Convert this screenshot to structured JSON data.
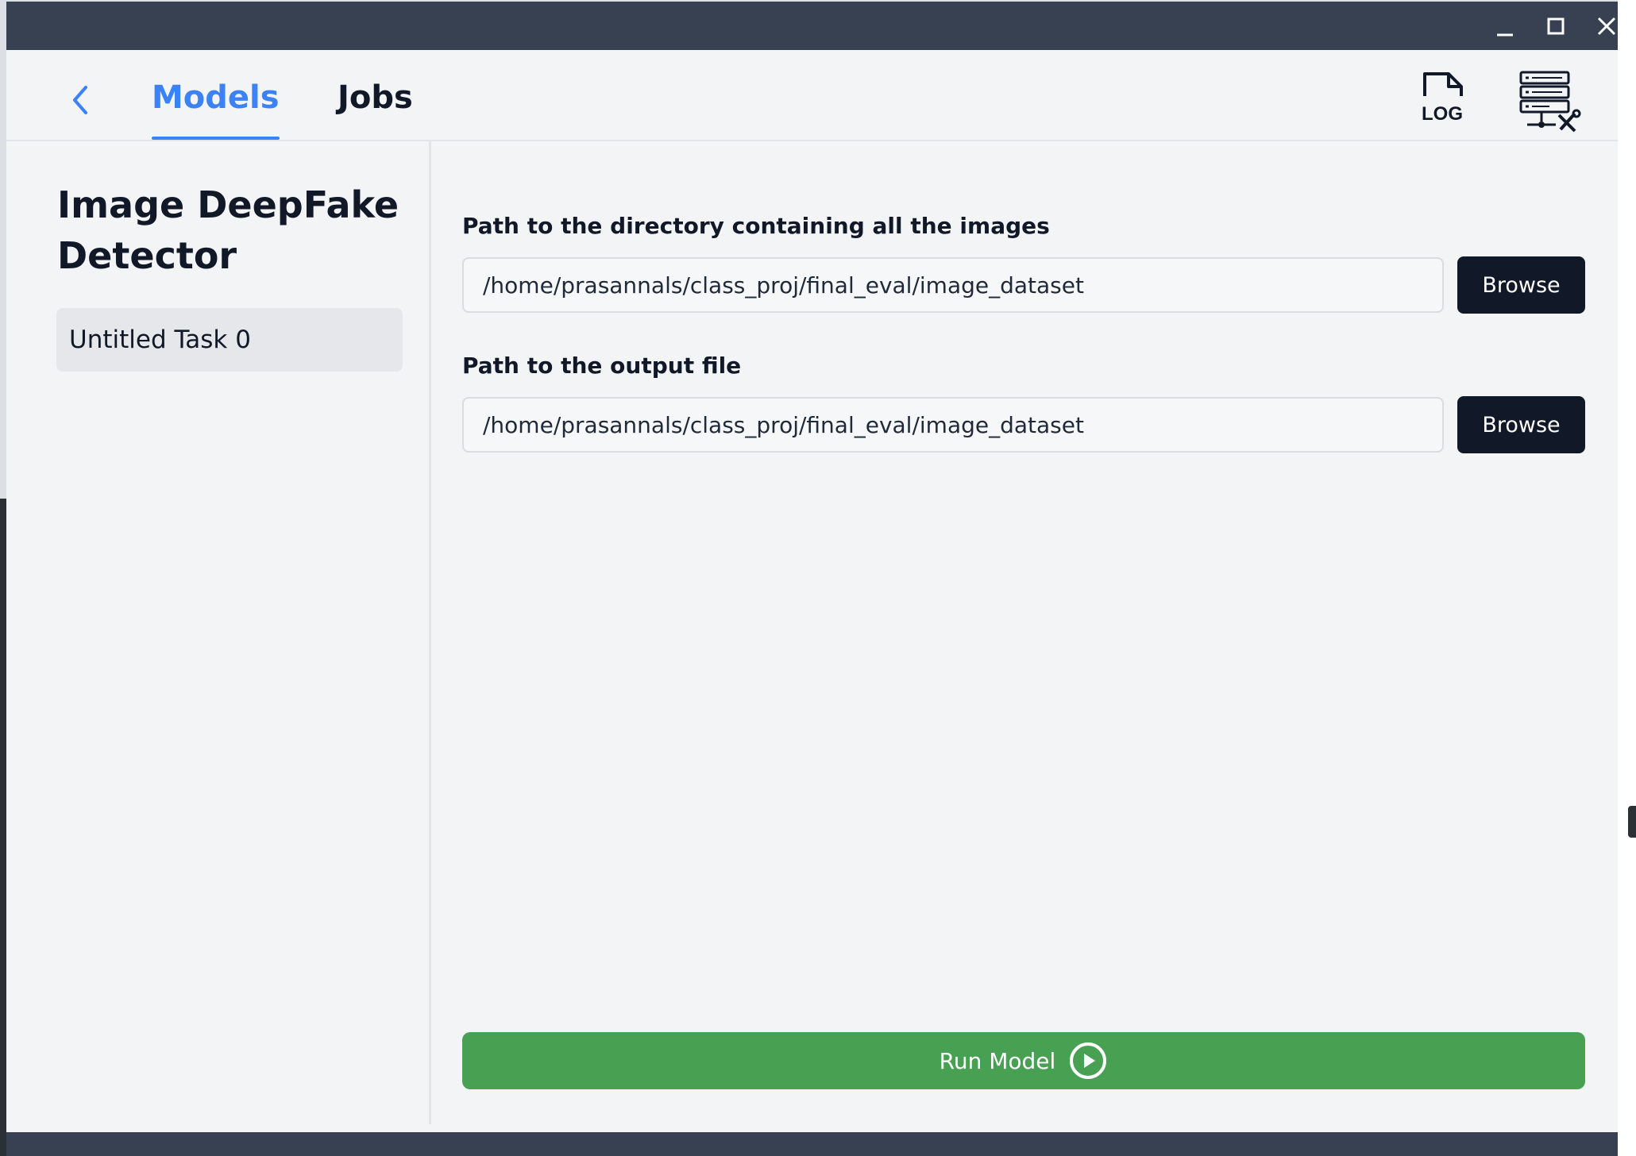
{
  "nav": {
    "tabs": [
      {
        "label": "Models",
        "active": true
      },
      {
        "label": "Jobs",
        "active": false
      }
    ],
    "log_icon_text": "LOG"
  },
  "sidebar": {
    "title": "Image DeepFake Detector",
    "tasks": [
      {
        "label": "Untitled Task 0",
        "selected": true
      }
    ]
  },
  "form": {
    "images_dir": {
      "label": "Path to the directory containing all the images",
      "value": "/home/prasannals/class_proj/final_eval/image_dataset",
      "browse_label": "Browse"
    },
    "output_file": {
      "label": "Path to the output file",
      "value": "/home/prasannals/class_proj/final_eval/image_dataset",
      "browse_label": "Browse"
    },
    "run_label": "Run Model"
  },
  "icons": {
    "back": "chevron-left-icon",
    "log": "log-file-icon",
    "server": "server-settings-icon",
    "run": "play-circle-icon",
    "window": [
      "minimize-icon",
      "maximize-icon",
      "close-icon"
    ]
  },
  "colors": {
    "accent": "#3b82f6",
    "run_button": "#48a153",
    "browse_button": "#111827",
    "titlebar": "#374151",
    "background": "#f3f4f6"
  }
}
